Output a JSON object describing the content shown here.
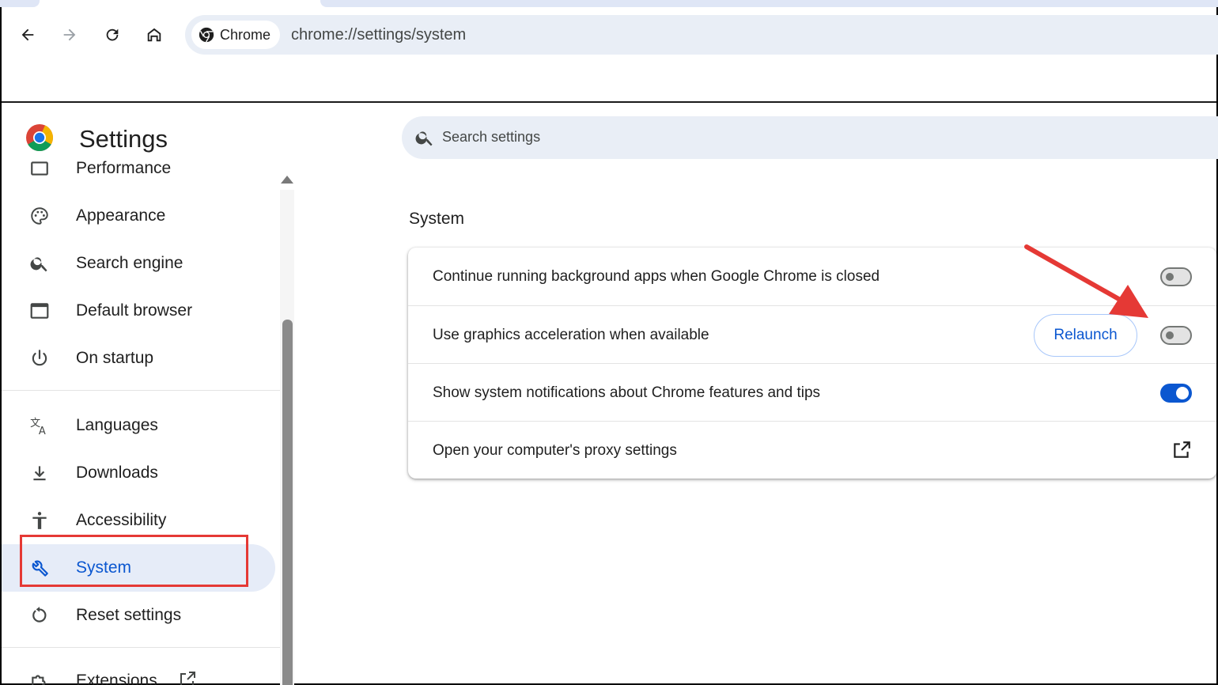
{
  "browser": {
    "chip_label": "Chrome",
    "url": "chrome://settings/system"
  },
  "header": {
    "title": "Settings",
    "search_placeholder": "Search settings"
  },
  "sidebar": {
    "items": [
      {
        "label": "Performance",
        "icon": "gauge-icon"
      },
      {
        "label": "Appearance",
        "icon": "palette-icon"
      },
      {
        "label": "Search engine",
        "icon": "search-icon"
      },
      {
        "label": "Default browser",
        "icon": "browser-window-icon"
      },
      {
        "label": "On startup",
        "icon": "power-icon"
      },
      {
        "label": "Languages",
        "icon": "translate-icon"
      },
      {
        "label": "Downloads",
        "icon": "download-icon"
      },
      {
        "label": "Accessibility",
        "icon": "accessibility-icon"
      },
      {
        "label": "System",
        "icon": "wrench-icon",
        "active": true
      },
      {
        "label": "Reset settings",
        "icon": "reset-icon"
      },
      {
        "label": "Extensions",
        "icon": "puzzle-icon"
      }
    ]
  },
  "main": {
    "section_title": "System",
    "rows": [
      {
        "label": "Continue running background apps when Google Chrome is closed",
        "toggle": "off"
      },
      {
        "label": "Use graphics acceleration when available",
        "toggle": "off",
        "button": "Relaunch"
      },
      {
        "label": "Show system notifications about Chrome features and tips",
        "toggle": "on"
      },
      {
        "label": "Open your computer's proxy settings",
        "control": "external-link-icon"
      }
    ]
  },
  "colors": {
    "accent": "#0b57d0",
    "active_bg": "#e6ecf8",
    "annotation": "#e53935"
  }
}
